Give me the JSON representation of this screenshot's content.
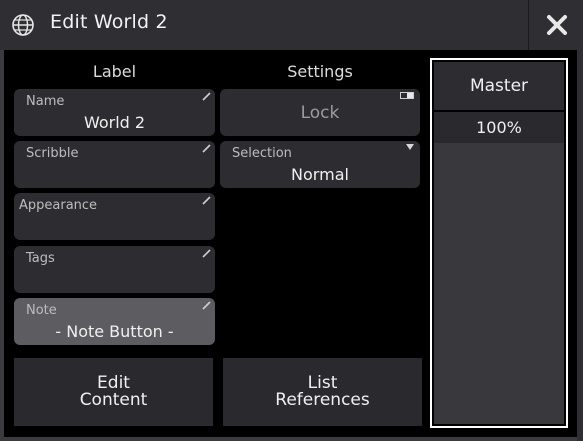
{
  "window": {
    "title": "Edit World 2",
    "title_icon": "globe-icon",
    "close_icon": "close-icon"
  },
  "label_column": {
    "header": "Label",
    "fields": [
      {
        "label": "Name",
        "value": "World 2"
      },
      {
        "label": "Scribble",
        "value": ""
      },
      {
        "label": "Appearance",
        "value": ""
      },
      {
        "label": "Tags",
        "value": ""
      },
      {
        "label": "Note",
        "value": "- Note Button -"
      }
    ]
  },
  "settings_column": {
    "header": "Settings",
    "lock": {
      "value": "Lock"
    },
    "selection": {
      "label": "Selection",
      "value": "Normal"
    }
  },
  "buttons": {
    "edit_content": [
      "Edit",
      "Content"
    ],
    "list_references": [
      "List",
      "References"
    ]
  },
  "master": {
    "label": "Master",
    "value": "100%",
    "level_percent": 100
  },
  "colors": {
    "background": "#000000",
    "field_bg": "#2d2d31",
    "note_bg": "#5c5c61",
    "titlebar": "#2f2f33",
    "master_border": "#ffffff"
  }
}
